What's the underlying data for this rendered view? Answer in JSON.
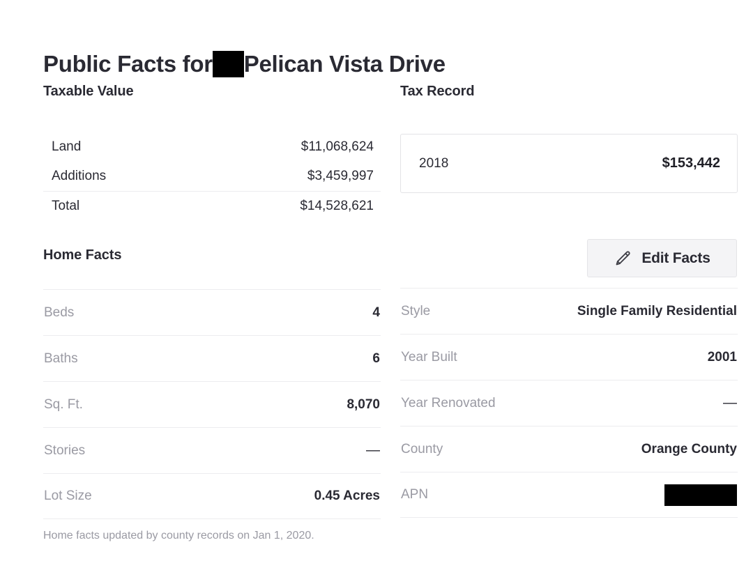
{
  "page": {
    "title_prefix": "Public Facts for",
    "title_redacted": true,
    "title_suffix": "Pelican Vista Drive",
    "accent_colors": {
      "text_primary": "#2a2a33",
      "text_muted": "#9a9aa3",
      "divider": "#ececef",
      "button_bg": "#f4f4f6",
      "redaction": "#000000"
    }
  },
  "taxable_value": {
    "heading": "Taxable Value",
    "rows": [
      {
        "label": "Land",
        "value": "$11,068,624",
        "divider_above": false
      },
      {
        "label": "Additions",
        "value": "$3,459,997",
        "divider_above": false
      },
      {
        "label": "Total",
        "value": "$14,528,621",
        "divider_above": true
      }
    ]
  },
  "tax_record": {
    "heading": "Tax Record",
    "entries": [
      {
        "year": "2018",
        "amount": "$153,442"
      }
    ]
  },
  "home_facts": {
    "heading": "Home Facts",
    "edit_button": {
      "label": "Edit Facts",
      "icon": "pencil-icon"
    },
    "left_rows": [
      {
        "label": "Beds",
        "value": "4",
        "redacted": false
      },
      {
        "label": "Baths",
        "value": "6",
        "redacted": false
      },
      {
        "label": "Sq. Ft.",
        "value": "8,070",
        "redacted": false
      },
      {
        "label": "Stories",
        "value": "—",
        "redacted": false
      },
      {
        "label": "Lot Size",
        "value": "0.45 Acres",
        "redacted": false
      }
    ],
    "right_rows": [
      {
        "label": "Style",
        "value": "Single Family Residential",
        "redacted": false
      },
      {
        "label": "Year Built",
        "value": "2001",
        "redacted": false
      },
      {
        "label": "Year Renovated",
        "value": "—",
        "redacted": false
      },
      {
        "label": "County",
        "value": "Orange County",
        "redacted": false
      },
      {
        "label": "APN",
        "value": "",
        "redacted": true
      }
    ],
    "footnote": "Home facts updated by county records on Jan 1, 2020."
  }
}
